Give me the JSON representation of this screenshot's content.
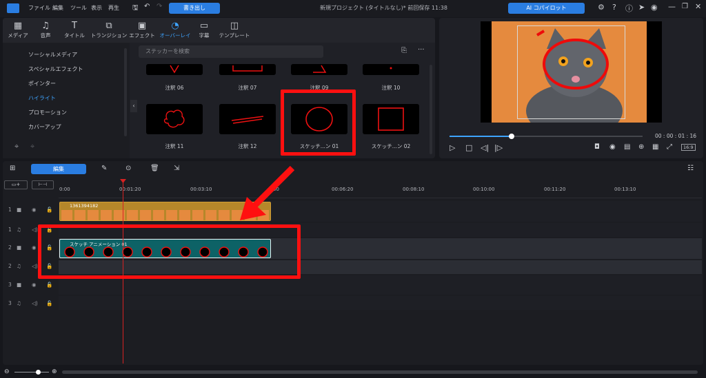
{
  "titlebar": {
    "menus": [
      "ファイル",
      "編集",
      "ツール",
      "表示",
      "再生"
    ],
    "export_label": "書き出し",
    "window_title": "新規プロジェクト (タイトルなし)* 前回保存 11:38",
    "ai_label": "AI コパイロット"
  },
  "library": {
    "tabs": [
      "メディア",
      "音声",
      "タイトル",
      "トランジション",
      "エフェクト",
      "オーバーレイ",
      "字幕",
      "テンプレート"
    ],
    "active_tab": "オーバーレイ",
    "categories": [
      "ソーシャルメディア",
      "スペシャルエフェクト",
      "ポインター",
      "ハイライト",
      "プロモーション",
      "カバーアップ"
    ],
    "active_category": "ハイライト",
    "search_placeholder": "ステッカーを検索",
    "stickers_row1": [
      "注釈 06",
      "注釈 07",
      "注釈 09",
      "注釈 10"
    ],
    "stickers_row2": [
      "注釈 11",
      "注釈 12",
      "スケッチ...ン 01",
      "スケッチ...ン 02"
    ]
  },
  "preview": {
    "timecode": "00 : 00 : 01 : 16",
    "aspect": "16:9",
    "progress": 0.32
  },
  "timeline": {
    "edit_label": "編集",
    "ruler": [
      "0:00",
      "00:01:20",
      "00:03:10",
      "00",
      "00:06:20",
      "00:08:10",
      "00:10:00",
      "00:11:20",
      "00:13:10"
    ],
    "tracks": [
      {
        "num": "1",
        "type": "video"
      },
      {
        "num": "1",
        "type": "audio"
      },
      {
        "num": "2",
        "type": "video"
      },
      {
        "num": "2",
        "type": "audio"
      },
      {
        "num": "3",
        "type": "video"
      },
      {
        "num": "3",
        "type": "audio"
      }
    ],
    "clip_video_title": "1361394182",
    "clip_sketch_title": "スケッチ アニメーション 01"
  }
}
